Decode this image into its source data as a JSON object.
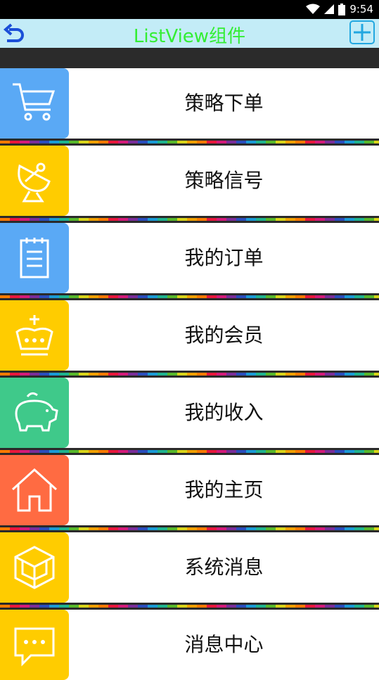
{
  "status_bar": {
    "time": "9:54"
  },
  "title_bar": {
    "title": "ListView组件"
  },
  "items": [
    {
      "label": "策略下单",
      "icon": "cart-icon",
      "color": "#5aa9f5"
    },
    {
      "label": "策略信号",
      "icon": "satellite-dish-icon",
      "color": "#ffcc00"
    },
    {
      "label": "我的订单",
      "icon": "notepad-icon",
      "color": "#5aa9f5"
    },
    {
      "label": "我的会员",
      "icon": "crown-icon",
      "color": "#ffcc00"
    },
    {
      "label": "我的收入",
      "icon": "piggy-bank-icon",
      "color": "#3fc98a"
    },
    {
      "label": "我的主页",
      "icon": "home-icon",
      "color": "#ff6b42"
    },
    {
      "label": "系统消息",
      "icon": "cube-icon",
      "color": "#ffcc00"
    },
    {
      "label": "消息中心",
      "icon": "chat-bubble-icon",
      "color": "#ffcc00"
    }
  ]
}
